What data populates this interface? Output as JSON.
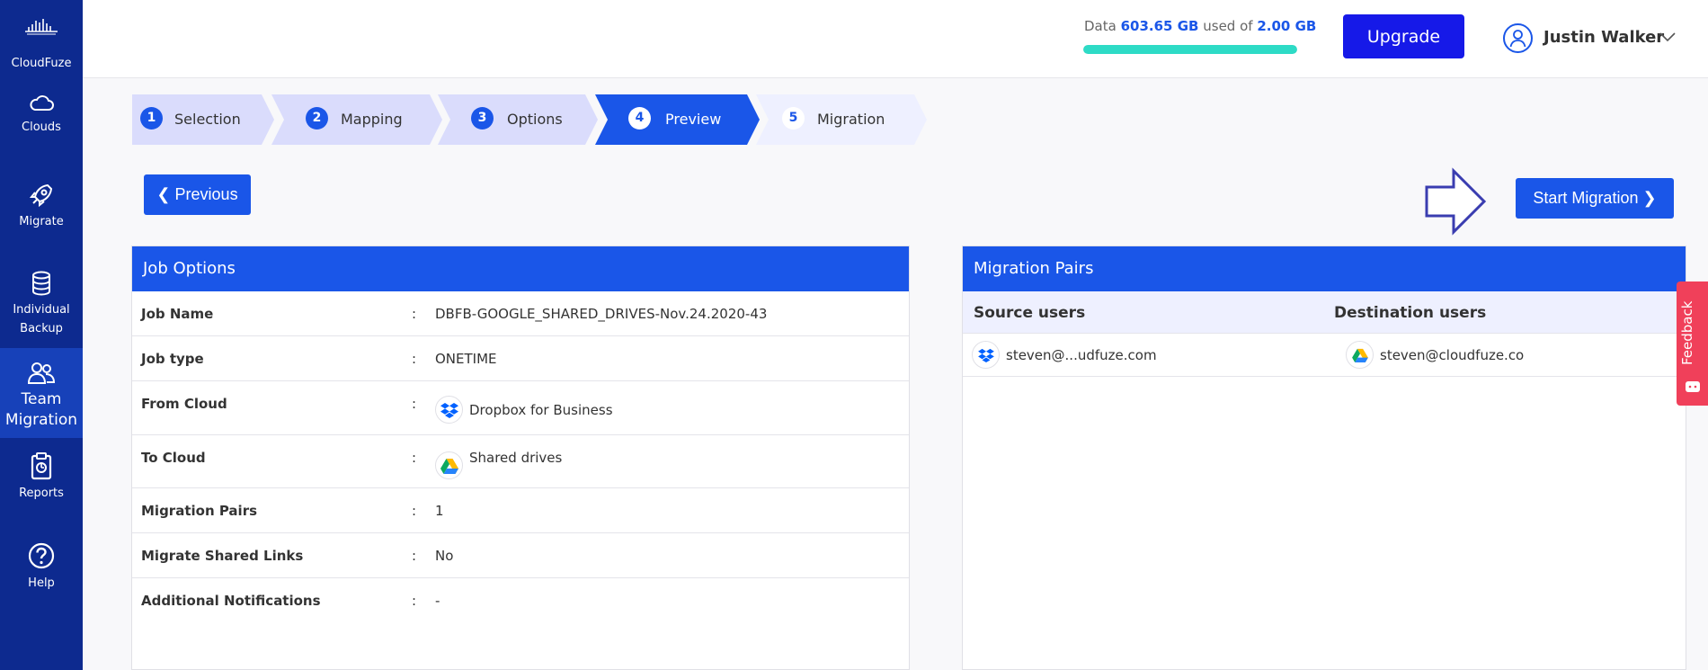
{
  "sidebar": {
    "logo_text": "CloudFuze",
    "items": [
      {
        "label": "Clouds",
        "icon": "cloud-icon"
      },
      {
        "label": "Migrate",
        "icon": "rocket-icon"
      },
      {
        "label": "Individual Backup",
        "icon": "database-icon"
      },
      {
        "label": "Team Migration",
        "icon": "team-icon"
      },
      {
        "label": "Reports",
        "icon": "clipboard-icon"
      },
      {
        "label": "Help",
        "icon": "help-icon"
      }
    ]
  },
  "header": {
    "usage_prefix": "Data",
    "used": "603.65 GB",
    "usage_middle": "used of",
    "total": "2.00 GB",
    "usage_fill_percent": 100,
    "upgrade_label": "Upgrade",
    "user_name": "Justin Walker"
  },
  "steps": [
    {
      "num": "1",
      "label": "Selection"
    },
    {
      "num": "2",
      "label": "Mapping"
    },
    {
      "num": "3",
      "label": "Options"
    },
    {
      "num": "4",
      "label": "Preview"
    },
    {
      "num": "5",
      "label": "Migration"
    }
  ],
  "buttons": {
    "previous": "Previous",
    "start": "Start Migration"
  },
  "job_options": {
    "title": "Job Options",
    "separator": ":",
    "rows": [
      {
        "key": "Job Name",
        "value": "DBFB-GOOGLE_SHARED_DRIVES-Nov.24.2020-43"
      },
      {
        "key": "Job type",
        "value": "ONETIME"
      },
      {
        "key": "From Cloud",
        "value": "Dropbox for Business"
      },
      {
        "key": "To Cloud",
        "value": "Shared drives"
      },
      {
        "key": "Migration Pairs",
        "value": "1"
      },
      {
        "key": "Migrate Shared Links",
        "value": "No"
      },
      {
        "key": "Additional Notifications",
        "value": "-"
      }
    ]
  },
  "migration_pairs": {
    "title": "Migration Pairs",
    "source_header": "Source users",
    "dest_header": "Destination users",
    "rows": [
      {
        "source": "steven@...udfuze.com",
        "destination": "steven@cloudfuze.co"
      }
    ]
  },
  "feedback": {
    "label": "Feedback"
  },
  "colors": {
    "sidebar": "#0d2a8f",
    "primary": "#1a56e8",
    "upgrade": "#1619e8",
    "usage_fill": "#2ddbc6",
    "feedback": "#f0405a"
  }
}
